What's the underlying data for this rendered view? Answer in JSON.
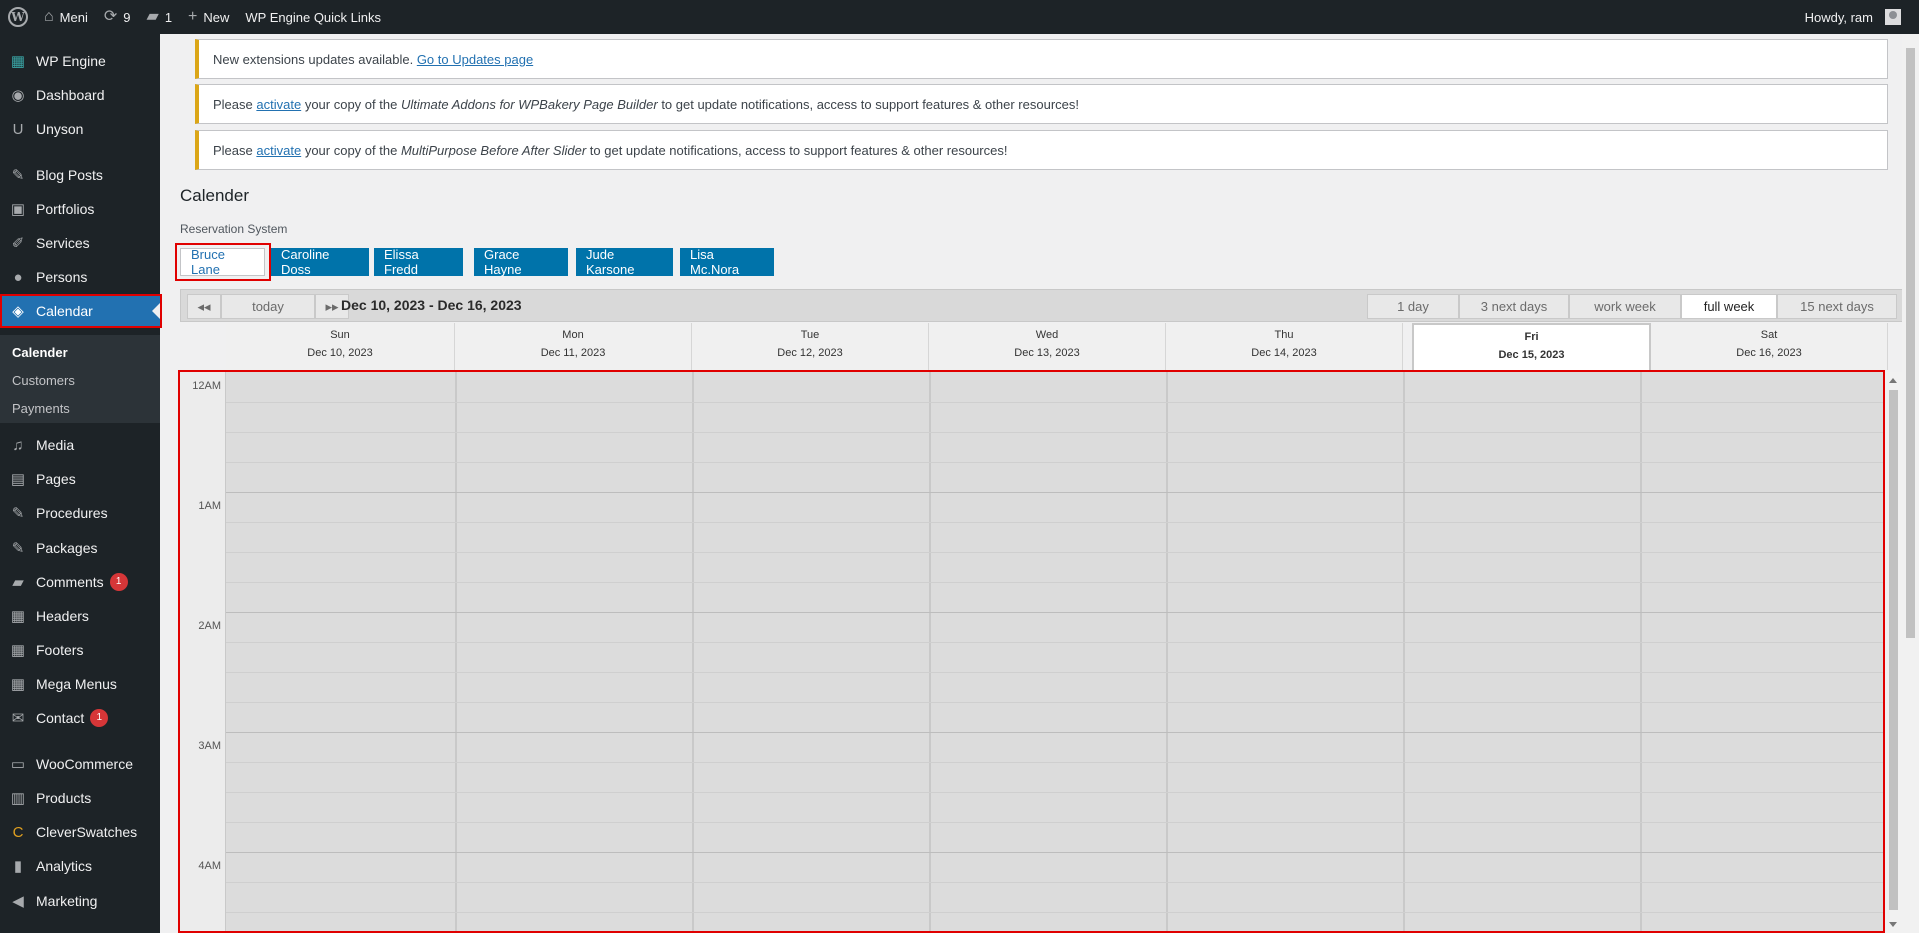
{
  "adminbar": {
    "site_name": "Meni",
    "updates_count": "9",
    "comments_count": "1",
    "new_label": "New",
    "quick_links": "WP Engine Quick Links",
    "howdy": "Howdy, ram"
  },
  "sidebar": {
    "items": [
      {
        "label": "WP Engine",
        "icon": "grid-icon"
      },
      {
        "label": "Dashboard",
        "icon": "dashboard-icon"
      },
      {
        "label": "Unyson",
        "icon": "unyson-icon"
      },
      {
        "label": "Blog Posts",
        "icon": "pin-icon"
      },
      {
        "label": "Portfolios",
        "icon": "portfolio-icon"
      },
      {
        "label": "Services",
        "icon": "carrot-icon"
      },
      {
        "label": "Persons",
        "icon": "person-icon"
      },
      {
        "label": "Calendar",
        "icon": "tag-icon"
      },
      {
        "label": "Media",
        "icon": "media-icon"
      },
      {
        "label": "Pages",
        "icon": "pages-icon"
      },
      {
        "label": "Procedures",
        "icon": "pin-icon"
      },
      {
        "label": "Packages",
        "icon": "pin-icon"
      },
      {
        "label": "Comments",
        "icon": "comment-icon",
        "badge": "1"
      },
      {
        "label": "Headers",
        "icon": "grid-icon"
      },
      {
        "label": "Footers",
        "icon": "grid-icon"
      },
      {
        "label": "Mega Menus",
        "icon": "grid-icon"
      },
      {
        "label": "Contact",
        "icon": "mail-icon",
        "badge": "1"
      },
      {
        "label": "WooCommerce",
        "icon": "woo-icon"
      },
      {
        "label": "Products",
        "icon": "archive-icon"
      },
      {
        "label": "CleverSwatches",
        "icon": "swatch-icon"
      },
      {
        "label": "Analytics",
        "icon": "chart-icon"
      },
      {
        "label": "Marketing",
        "icon": "megaphone-icon"
      }
    ],
    "submenu": [
      "Calender",
      "Customers",
      "Payments"
    ]
  },
  "notices": {
    "n1_text": "New extensions updates available.",
    "n1_link": "Go to Updates page",
    "n2_pre": "Please",
    "n2_link": "activate",
    "n2_mid": "your copy of the",
    "n2_product": "Ultimate Addons for WPBakery Page Builder",
    "n2_post": "to get update notifications, access to support features & other resources!",
    "n3_pre": "Please",
    "n3_link": "activate",
    "n3_mid": "your copy of the",
    "n3_product": "MultiPurpose Before After Slider",
    "n3_post": "to get update notifications, access to support features & other resources!"
  },
  "page": {
    "title": "Calender",
    "subtitle": "Reservation System",
    "persons": [
      "Bruce Lane",
      "Caroline Doss",
      "Elissa Fredd",
      "Grace Hayne",
      "Jude Karsone",
      "Lisa Mc.Nora"
    ]
  },
  "calendar": {
    "prev": "◂◂",
    "today": "today",
    "next": "▸▸",
    "range": "Dec 10, 2023 - Dec 16, 2023",
    "views": [
      "1 day",
      "3 next days",
      "work week",
      "full week",
      "15 next days"
    ],
    "selected_view": "full week",
    "days": [
      {
        "name": "Sun",
        "date": "Dec 10, 2023"
      },
      {
        "name": "Mon",
        "date": "Dec 11, 2023"
      },
      {
        "name": "Tue",
        "date": "Dec 12, 2023"
      },
      {
        "name": "Wed",
        "date": "Dec 13, 2023"
      },
      {
        "name": "Thu",
        "date": "Dec 14, 2023"
      },
      {
        "name": "Fri",
        "date": "Dec 15, 2023"
      },
      {
        "name": "Sat",
        "date": "Dec 16, 2023"
      }
    ],
    "today_day": "Fri",
    "hours": [
      "12AM",
      "1AM",
      "2AM",
      "3AM",
      "4AM"
    ]
  },
  "colors": {
    "admin_dark": "#1d2327",
    "accent_blue": "#2271b1",
    "button_blue": "#0073aa",
    "highlight_red": "#e00000",
    "notice_yellow": "#dba617"
  }
}
